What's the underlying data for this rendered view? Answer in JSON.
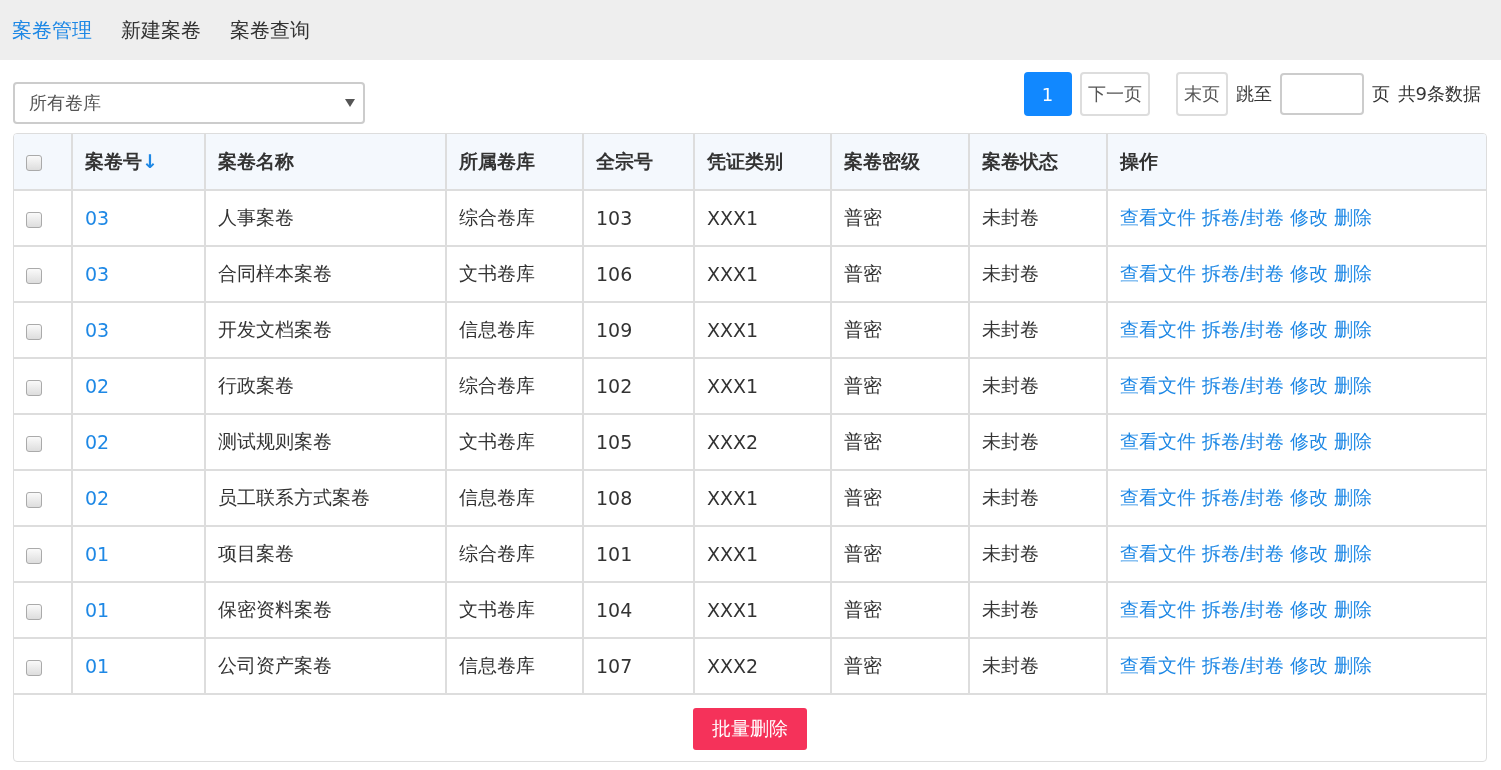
{
  "nav": [
    {
      "label": "案卷管理",
      "selected": true
    },
    {
      "label": "新建案卷",
      "selected": false
    },
    {
      "label": "案卷查询",
      "selected": false
    }
  ],
  "filter": {
    "value": "所有卷库"
  },
  "pagination": {
    "pages": [
      {
        "label": "1",
        "selected": true
      }
    ],
    "next": "下一页",
    "last": "末页",
    "jump_label": "跳至",
    "page_unit": "页",
    "total": "共9条数据"
  },
  "table": {
    "header_checked": false,
    "columns": [
      {
        "label": "案卷号",
        "sort_mark": "↓"
      },
      {
        "label": "案卷名称"
      },
      {
        "label": "所属卷库"
      },
      {
        "label": "全宗号"
      },
      {
        "label": "凭证类别"
      },
      {
        "label": "案卷密级"
      },
      {
        "label": "案卷状态"
      },
      {
        "label": "操作"
      }
    ],
    "rows": [
      {
        "checked": false,
        "cells": [
          "03",
          "人事案卷",
          "综合卷库",
          "103",
          "XXX1",
          "普密",
          "未封卷"
        ],
        "actions": [
          "查看文件",
          "拆卷/封卷",
          "修改",
          "删除"
        ]
      },
      {
        "checked": false,
        "cells": [
          "03",
          "合同样本案卷",
          "文书卷库",
          "106",
          "XXX1",
          "普密",
          "未封卷"
        ],
        "actions": [
          "查看文件",
          "拆卷/封卷",
          "修改",
          "删除"
        ]
      },
      {
        "checked": false,
        "cells": [
          "03",
          "开发文档案卷",
          "信息卷库",
          "109",
          "XXX1",
          "普密",
          "未封卷"
        ],
        "actions": [
          "查看文件",
          "拆卷/封卷",
          "修改",
          "删除"
        ]
      },
      {
        "checked": false,
        "cells": [
          "02",
          "行政案卷",
          "综合卷库",
          "102",
          "XXX1",
          "普密",
          "未封卷"
        ],
        "actions": [
          "查看文件",
          "拆卷/封卷",
          "修改",
          "删除"
        ]
      },
      {
        "checked": false,
        "cells": [
          "02",
          "测试规则案卷",
          "文书卷库",
          "105",
          "XXX2",
          "普密",
          "未封卷"
        ],
        "actions": [
          "查看文件",
          "拆卷/封卷",
          "修改",
          "删除"
        ]
      },
      {
        "checked": false,
        "cells": [
          "02",
          "员工联系方式案卷",
          "信息卷库",
          "108",
          "XXX1",
          "普密",
          "未封卷"
        ],
        "actions": [
          "查看文件",
          "拆卷/封卷",
          "修改",
          "删除"
        ]
      },
      {
        "checked": false,
        "cells": [
          "01",
          "项目案卷",
          "综合卷库",
          "101",
          "XXX1",
          "普密",
          "未封卷"
        ],
        "actions": [
          "查看文件",
          "拆卷/封卷",
          "修改",
          "删除"
        ]
      },
      {
        "checked": false,
        "cells": [
          "01",
          "保密资料案卷",
          "文书卷库",
          "104",
          "XXX1",
          "普密",
          "未封卷"
        ],
        "actions": [
          "查看文件",
          "拆卷/封卷",
          "修改",
          "删除"
        ]
      },
      {
        "checked": false,
        "cells": [
          "01",
          "公司资产案卷",
          "信息卷库",
          "107",
          "XXX2",
          "普密",
          "未封卷"
        ],
        "actions": [
          "查看文件",
          "拆卷/封卷",
          "修改",
          "删除"
        ]
      }
    ]
  },
  "batch_button": "批量删除"
}
